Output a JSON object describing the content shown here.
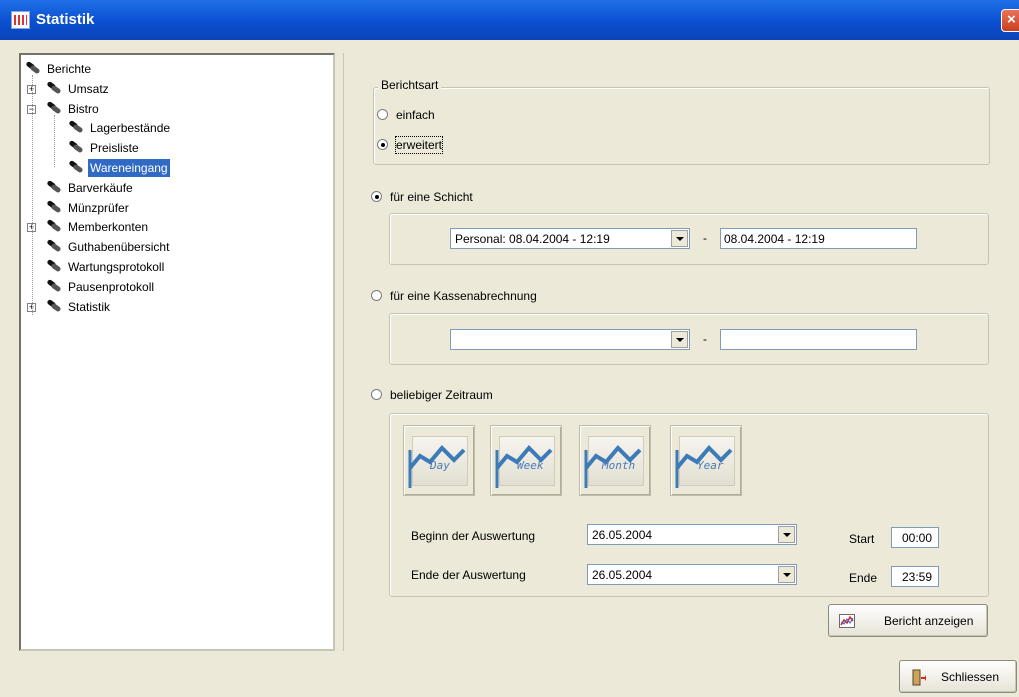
{
  "window": {
    "title": "Statistik",
    "close_glyph": "×"
  },
  "tree": {
    "items": [
      {
        "label": "Berichte",
        "level": 0,
        "expander": "",
        "selected": false
      },
      {
        "label": "Umsatz",
        "level": 1,
        "expander": "+",
        "selected": false
      },
      {
        "label": "Bistro",
        "level": 1,
        "expander": "−",
        "selected": false
      },
      {
        "label": "Lagerbestände",
        "level": 2,
        "expander": "",
        "selected": false
      },
      {
        "label": "Preisliste",
        "level": 2,
        "expander": "",
        "selected": false
      },
      {
        "label": "Wareneingang",
        "level": 2,
        "expander": "",
        "selected": true
      },
      {
        "label": "Barverkäufe",
        "level": 1,
        "expander": "",
        "selected": false
      },
      {
        "label": "Münzprüfer",
        "level": 1,
        "expander": "",
        "selected": false
      },
      {
        "label": "Memberkonten",
        "level": 1,
        "expander": "+",
        "selected": false
      },
      {
        "label": "Guthabenübersicht",
        "level": 1,
        "expander": "",
        "selected": false
      },
      {
        "label": "Wartungsprotokoll",
        "level": 1,
        "expander": "",
        "selected": false
      },
      {
        "label": "Pausenprotokoll",
        "level": 1,
        "expander": "",
        "selected": false
      },
      {
        "label": "Statistik",
        "level": 1,
        "expander": "+",
        "selected": false
      }
    ]
  },
  "berichtsart": {
    "title": "Berichtsart",
    "options": [
      {
        "label": "einfach",
        "checked": false
      },
      {
        "label": "erweitert",
        "checked": true
      }
    ]
  },
  "schicht": {
    "label": "für eine Schicht",
    "checked": true,
    "combo_value": "Personal:  08.04.2004 - 12:19",
    "separator": "-",
    "end_value": "08.04.2004 - 12:19"
  },
  "kasse": {
    "label": "für eine Kassenabrechnung",
    "checked": false,
    "combo_value": "",
    "separator": "-",
    "end_value": ""
  },
  "zeitraum": {
    "label": "beliebiger Zeitraum",
    "checked": false,
    "period_buttons": [
      "Day",
      "Week",
      "Month",
      "Year"
    ],
    "begin_label": "Beginn der Auswertung",
    "begin_value": "26.05.2004",
    "end_label": "Ende der Auswertung",
    "end_value": "26.05.2004",
    "start_label": "Start",
    "start_time": "00:00",
    "ende_label": "Ende",
    "ende_time": "23:59"
  },
  "buttons": {
    "report_label": "Bericht anzeigen",
    "close_label": "Schliessen"
  },
  "colors": {
    "titlebar": "#0a4fd1",
    "selection": "#316ac5",
    "chart_line": "#3d7ab8"
  }
}
